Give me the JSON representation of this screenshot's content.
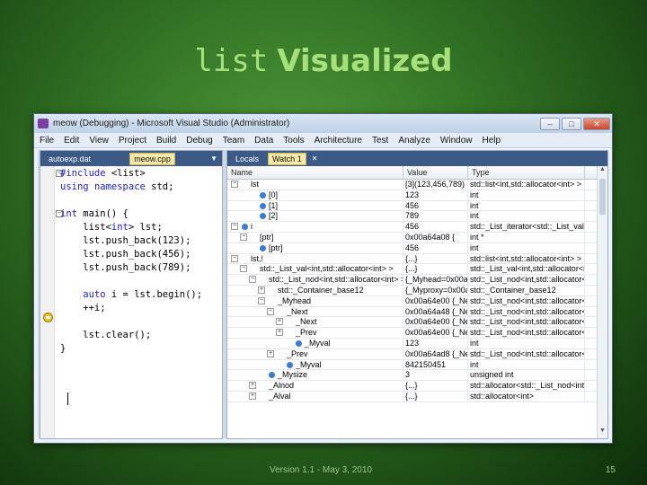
{
  "slide": {
    "title_code": "list",
    "title_word": "Visualized",
    "footer_version": "Version 1.1 - May 3, 2010",
    "page_number": "15"
  },
  "window": {
    "title": "meow (Debugging) - Microsoft Visual Studio (Administrator)",
    "buttons": {
      "minimize": "–",
      "maximize": "□",
      "close": "✕"
    }
  },
  "menu": [
    "File",
    "Edit",
    "View",
    "Project",
    "Build",
    "Debug",
    "Team",
    "Data",
    "Tools",
    "Architecture",
    "Test",
    "Analyze",
    "Window",
    "Help"
  ],
  "editor": {
    "tabs": [
      "autoexp.dat",
      "meow.cpp"
    ],
    "active_tab": "meow.cpp",
    "lines": [
      "#include <list>",
      "using namespace std;",
      "",
      "int main() {",
      "    list<int> lst;",
      "    lst.push_back(123);",
      "    lst.push_back(456);",
      "    lst.push_back(789);",
      "",
      "    auto i = lst.begin();",
      "    ++i;",
      "",
      "    lst.clear();",
      "}"
    ]
  },
  "watch": {
    "tabs": [
      "Locals",
      "Watch 1"
    ],
    "active_tab": "Watch 1",
    "columns": [
      "Name",
      "Value",
      "Type"
    ],
    "rows": [
      {
        "name": "lst",
        "value": "[3](123,456,789)",
        "type": "std::list<int,std::allocator<int> >"
      },
      {
        "name": "[0]",
        "value": "123",
        "type": "int"
      },
      {
        "name": "[1]",
        "value": "456",
        "type": "int"
      },
      {
        "name": "[2]",
        "value": "789",
        "type": "int"
      },
      {
        "name": "i",
        "value": "456",
        "type": "std::_List_iterator<std::_List_val<int"
      },
      {
        "name": "[ptr]",
        "value": "0x00a64a08 {",
        "type": "int *"
      },
      {
        "name": "[ptr]",
        "value": "456",
        "type": "int"
      },
      {
        "name": "lst,!",
        "value": "{...}",
        "type": "std::list<int,std::allocator<int> >"
      },
      {
        "name": "std::_List_val<int,std::allocator<int> >",
        "value": "{...}",
        "type": "std::_List_val<int,std::allocator<in"
      },
      {
        "name": "std::_List_nod<int,std::allocator<int> >",
        "value": "{_Myhead=0x00a6",
        "type": "std::_List_nod<int,std::allocator<in"
      },
      {
        "name": "std::_Container_base12",
        "value": "{_Myproxy=0x00a6",
        "type": "std::_Container_base12"
      },
      {
        "name": "_Myhead",
        "value": "0x00a64e00 {_Ne",
        "type": "std::_List_nod<int,std::allocator<in"
      },
      {
        "name": "_Next",
        "value": "0x00a64a48 {_Ne",
        "type": "std::_List_nod<int,std::allocator<in"
      },
      {
        "name": "_Next",
        "value": "0x00a64e00 {_Ne",
        "type": "std::_List_nod<int,std::allocator<in"
      },
      {
        "name": "_Prev",
        "value": "0x00a64e00 {_Ne",
        "type": "std::_List_nod<int,std::allocator<in"
      },
      {
        "name": "_Myval",
        "value": "123",
        "type": "int"
      },
      {
        "name": "_Prev",
        "value": "0x00a64ad8 {_Ne",
        "type": "std::_List_nod<int,std::allocator<in"
      },
      {
        "name": "_Myval",
        "value": "842150451",
        "type": "int"
      },
      {
        "name": "_Mysize",
        "value": "3",
        "type": "unsigned int"
      },
      {
        "name": "_Alnod",
        "value": "{...}",
        "type": "std::allocator<std::_List_nod<int,st"
      },
      {
        "name": "_Alval",
        "value": "{...}",
        "type": "std::allocator<int>"
      }
    ]
  },
  "colors": {
    "background": "#2f6e22",
    "title": "#a6e07a",
    "keyword": "#1c1cd6",
    "tab_bar": "#3b5a86"
  }
}
